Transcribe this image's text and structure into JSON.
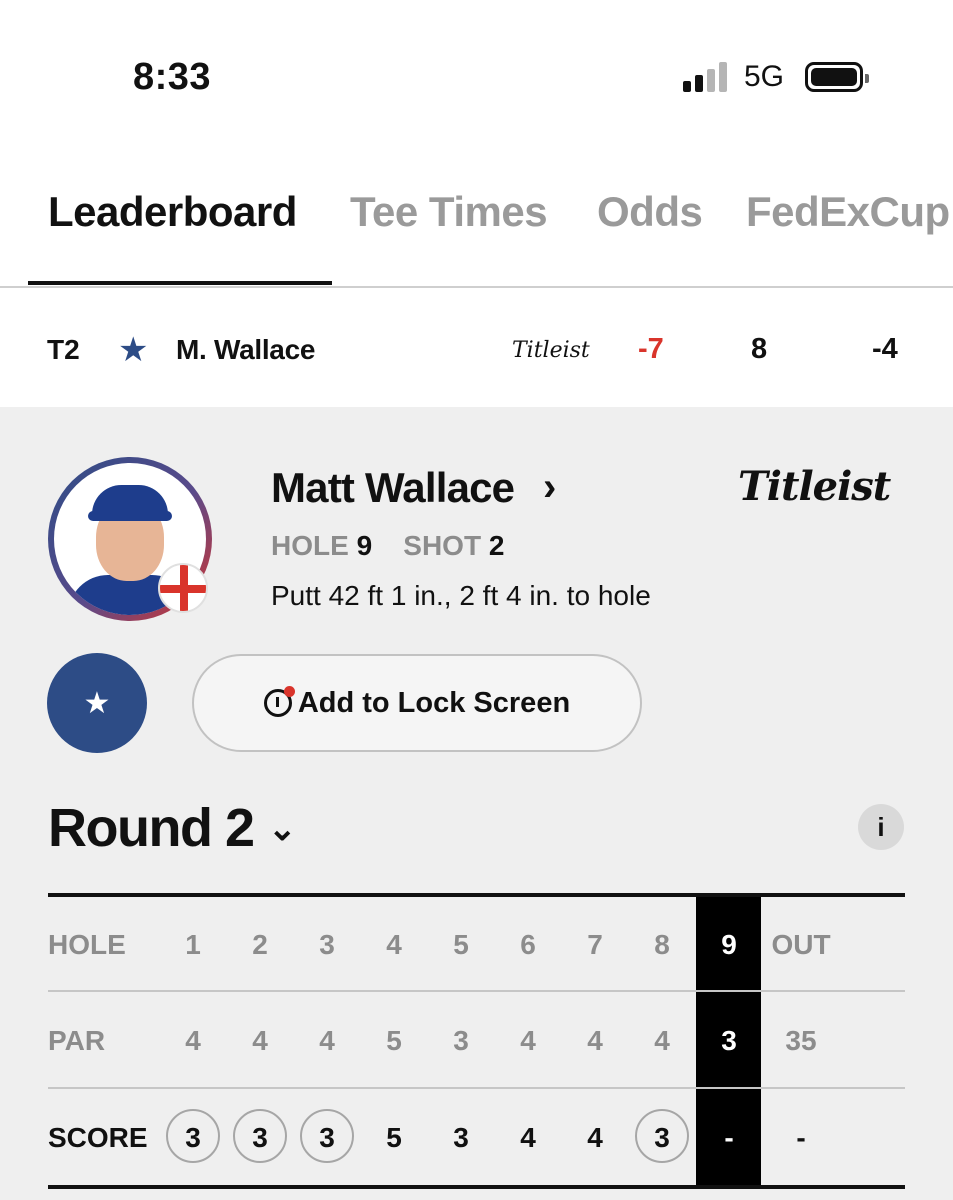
{
  "status": {
    "time": "8:33",
    "network": "5G"
  },
  "tabs": [
    {
      "label": "Leaderboard",
      "active": true
    },
    {
      "label": "Tee Times",
      "active": false
    },
    {
      "label": "Odds",
      "active": false
    },
    {
      "label": "FedExCup",
      "active": false
    }
  ],
  "summary": {
    "position": "T2",
    "favorite_icon": "star-icon",
    "name": "M. Wallace",
    "brand": "Titleist",
    "total": "-7",
    "thru": "8",
    "today": "-4"
  },
  "player": {
    "full_name": "Matt Wallace",
    "country_flag": "England",
    "brand": "Titleist",
    "hole_label": "HOLE",
    "hole": "9",
    "shot_label": "SHOT",
    "shot": "2",
    "shot_description": "Putt 42 ft 1 in., 2 ft 4 in. to hole"
  },
  "actions": {
    "lock_screen_label": "Add to Lock Screen"
  },
  "round": {
    "title": "Round 2",
    "info_label": "i"
  },
  "scorecard": {
    "hole_label": "HOLE",
    "par_label": "PAR",
    "score_label": "SCORE",
    "holes": [
      "1",
      "2",
      "3",
      "4",
      "5",
      "6",
      "7",
      "8",
      "9"
    ],
    "out_label": "OUT",
    "par": [
      "4",
      "4",
      "4",
      "5",
      "3",
      "4",
      "4",
      "4",
      "3"
    ],
    "par_out": "35",
    "score": [
      "3",
      "3",
      "3",
      "5",
      "3",
      "4",
      "4",
      "3",
      "-"
    ],
    "score_out": "-",
    "birdie_holes": [
      "1",
      "2",
      "3",
      "8"
    ],
    "current_hole": "9"
  },
  "colors": {
    "accent_blue": "#2d4c86",
    "under_par_red": "#d9342b",
    "panel_bg": "#efefef"
  }
}
